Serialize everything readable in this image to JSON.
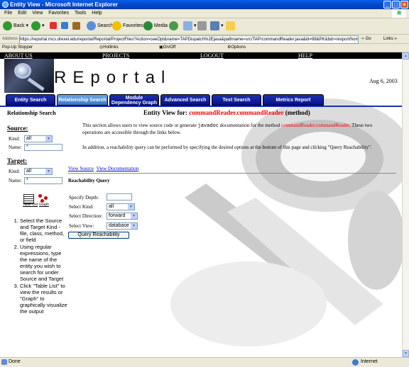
{
  "window": {
    "title": "Entity View - Microsoft Internet Explorer"
  },
  "menu": [
    "File",
    "Edit",
    "View",
    "Favorites",
    "Tools",
    "Help"
  ],
  "toolbar": {
    "back": "Back",
    "search": "Search",
    "favorites": "Favorites",
    "media": "Media"
  },
  "address": {
    "label": "Address",
    "url": "https://reportal.mcs.drexel.edu/reportal/Reportal/ProjectFiles?Action=ceeOpt&name=TAPDispatch%2Ejava&pathname=src/TAP/commandReader.java&id=98&PK&bdr=/export/hom",
    "go": "Go",
    "links": "Links"
  },
  "popupbar": {
    "label": "Pop-Up Stopper",
    "hotlinks": "Hotlinks",
    "onoff": "On/Off",
    "options": "Options"
  },
  "page": {
    "nav": [
      "ABOUT US",
      "PROJECTS",
      "LOGOUT",
      "HELP"
    ],
    "logo_text": "REportal",
    "date": "Aug 6, 2003",
    "tabs": [
      "Entity Search",
      "Relationship Search",
      "Module Dependency Graph",
      "Advanced Search",
      "Text Search",
      "Metrics Report"
    ],
    "active_tab": "Relationship Search",
    "sidebar": {
      "title": "Relationship Search",
      "source": {
        "heading": "Source:",
        "kind_label": "Kind:",
        "kind_value": "all",
        "name_label": "Name:",
        "name_value": "*"
      },
      "target": {
        "heading": "Target:",
        "kind_label": "Kind:",
        "kind_value": "all",
        "name_label": "Name:",
        "name_value": "*"
      },
      "table_list_label": "Table List",
      "graph_label": "Graph",
      "instructions": [
        "Select the Source and Target Kind - file, class, method, or field",
        "Using regular expressions, type the name of the entity you wish to search for under Source and Target",
        "Click \"Table List\" to view the results or \"Graph\" to graphically visualize the output"
      ]
    },
    "main": {
      "title_prefix": "Entity View for:",
      "entity": "commandReader.commandReader",
      "kind": "(method)",
      "p1_a": "This section allows users to view source code or generate",
      "p1_code": "javadoc",
      "p1_b": "documentation for the method",
      "p1_entity": "commandReader.commandReader",
      "p1_c": ". These two operations are accessible through the links below.",
      "p2": "In addition, a reachability query can be performed by specifying the desired options at the bottom of this page and clicking \"Query Reachability\".",
      "link_source": "View Source",
      "link_doc": "View Documentation",
      "reach_title": "Reachability Query",
      "depth_label": "Specify Depth:",
      "kind_label": "Select Kind:",
      "kind_value": "all",
      "direction_label": "Select Direction:",
      "direction_value": "forward",
      "view_label": "Select View:",
      "view_value": "database",
      "query_button": "Query Reachability"
    }
  },
  "status": {
    "left": "Done",
    "zone": "Internet"
  }
}
